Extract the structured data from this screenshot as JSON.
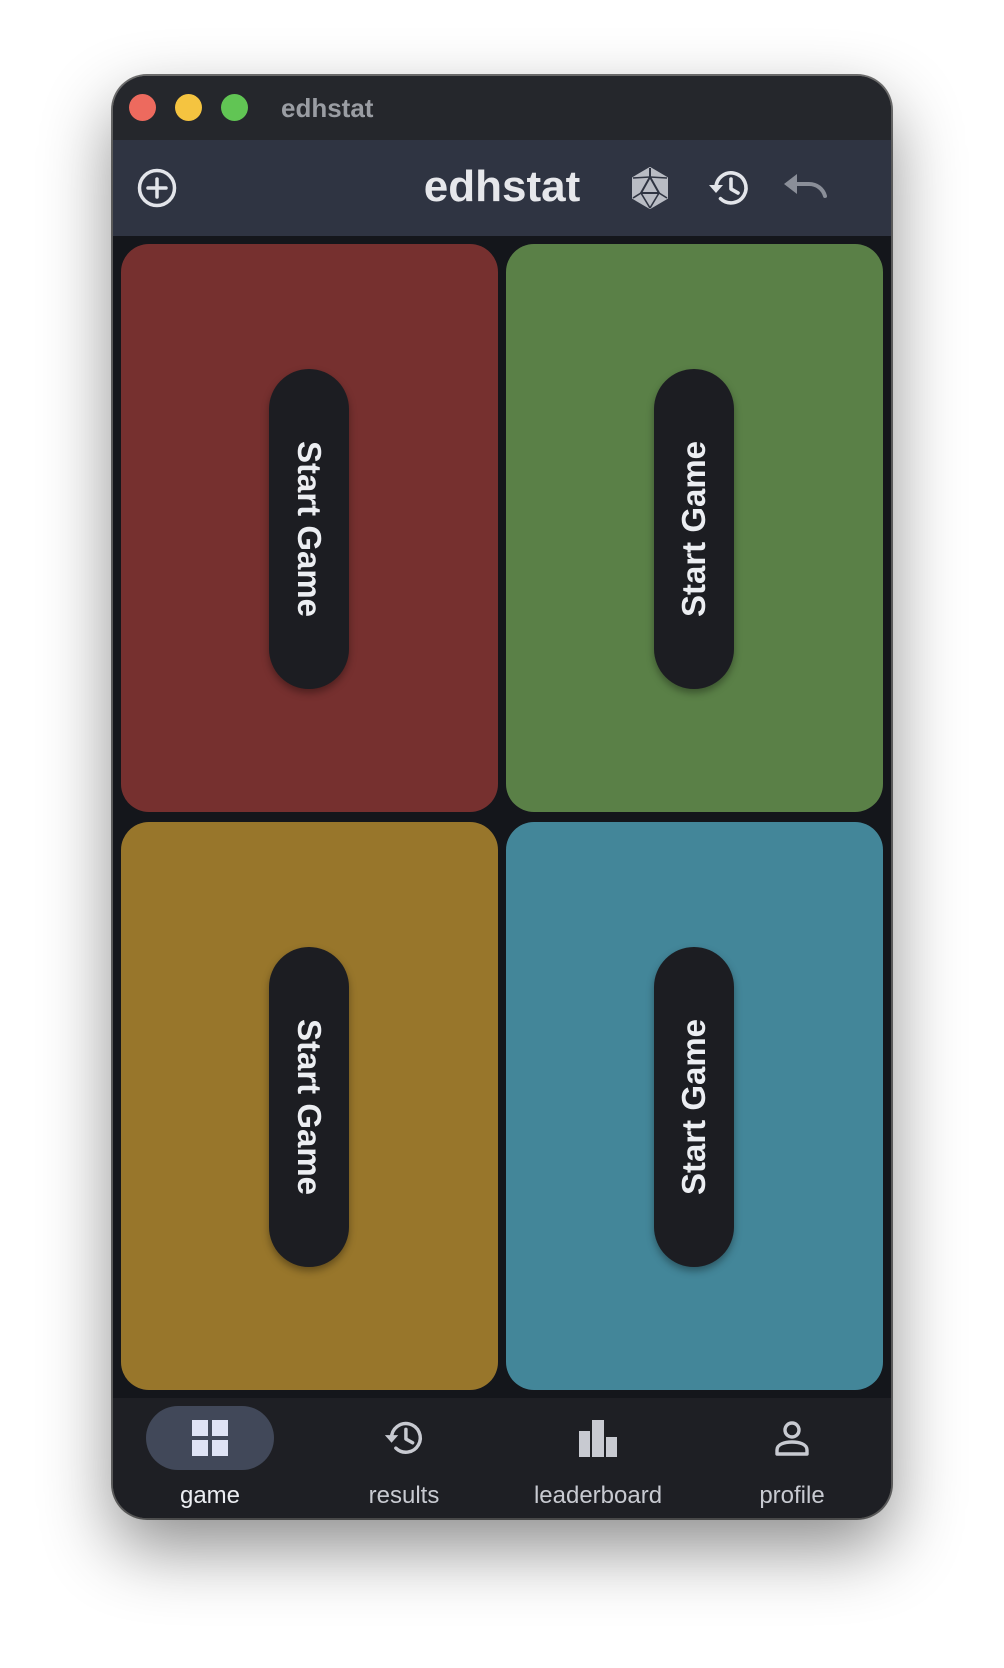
{
  "window": {
    "title": "edhstat"
  },
  "appbar": {
    "title": "edhstat",
    "add_icon": "add-circle-icon",
    "dice_icon": "d20-dice-icon",
    "history_icon": "history-icon",
    "undo_icon": "undo-icon"
  },
  "players": [
    {
      "button_label": "Start Game",
      "color": "#76302f"
    },
    {
      "button_label": "Start Game",
      "color": "#5a8047"
    },
    {
      "button_label": "Start Game",
      "color": "#98762b"
    },
    {
      "button_label": "Start Game",
      "color": "#438699"
    }
  ],
  "nav": {
    "items": [
      {
        "label": "game",
        "icon": "grid-icon",
        "active": true
      },
      {
        "label": "results",
        "icon": "history-icon",
        "active": false
      },
      {
        "label": "leaderboard",
        "icon": "bar-chart-icon",
        "active": false
      },
      {
        "label": "profile",
        "icon": "person-icon",
        "active": false
      }
    ]
  },
  "colors": {
    "background": "#14161b",
    "titlebar": "#25272c",
    "appbar": "#2f3442",
    "navbar": "#1e1f24",
    "nav_indicator": "#414859",
    "pill": "#1c1d22"
  }
}
